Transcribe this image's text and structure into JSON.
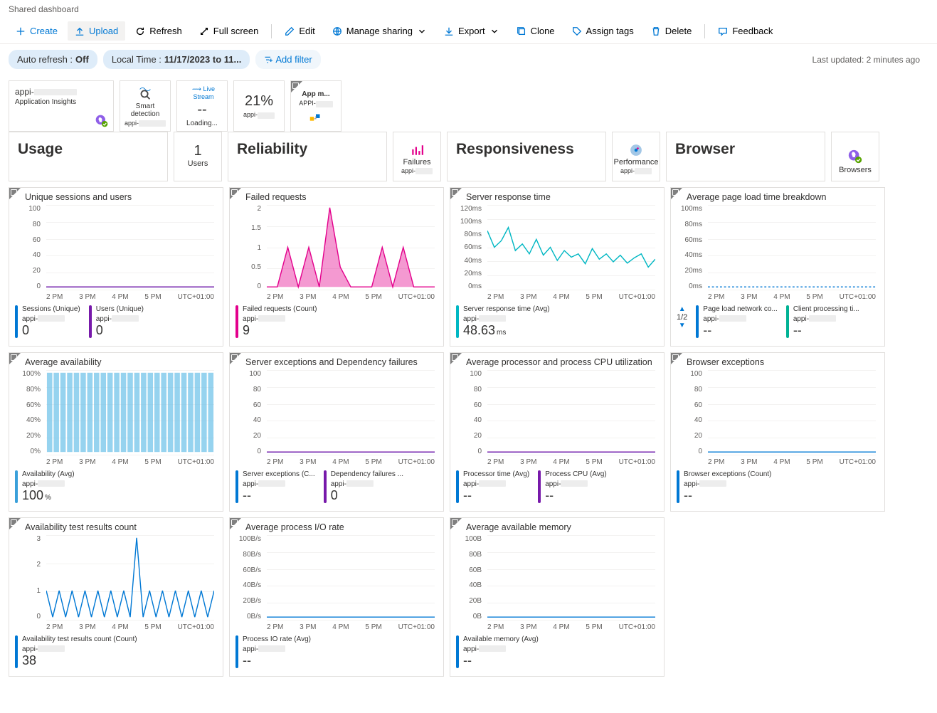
{
  "breadcrumb": "Shared dashboard",
  "toolbar": {
    "create": "Create",
    "upload": "Upload",
    "refresh": "Refresh",
    "fullscreen": "Full screen",
    "edit": "Edit",
    "sharing": "Manage sharing",
    "export": "Export",
    "clone": "Clone",
    "assign": "Assign tags",
    "delete": "Delete",
    "feedback": "Feedback"
  },
  "filters": {
    "autorefresh_label": "Auto refresh : ",
    "autorefresh_val": "Off",
    "time_label": "Local Time : ",
    "time_val": "11/17/2023 to 11...",
    "add": "Add filter"
  },
  "last_updated": "Last updated: 2 minutes ago",
  "top_tiles": {
    "ai": {
      "name": "appi-",
      "sub": "Application Insights"
    },
    "smart": {
      "title": "Smart detection",
      "sub": "appi-"
    },
    "live": {
      "title": "Live Stream",
      "val": "--",
      "sub": "Loading..."
    },
    "pct": {
      "val": "21%",
      "sub": "appi-"
    },
    "appmap": {
      "title": "App m...",
      "sub": "APPI-"
    }
  },
  "sections": {
    "usage": {
      "title": "Usage",
      "users_val": "1",
      "users_label": "Users"
    },
    "reliability": {
      "title": "Reliability",
      "aux": "Failures",
      "aux_sub": "appi-"
    },
    "responsiveness": {
      "title": "Responsiveness",
      "aux": "Performance",
      "aux_sub": "appi-"
    },
    "browser": {
      "title": "Browser",
      "aux": "Browsers"
    }
  },
  "charts": {
    "sessions": {
      "title": "Unique sessions and users",
      "m1": {
        "label": "Sessions (Unique)",
        "sub": "appi-",
        "val": "0"
      },
      "m2": {
        "label": "Users (Unique)",
        "sub": "appi-",
        "val": "0"
      }
    },
    "failed": {
      "title": "Failed requests",
      "m1": {
        "label": "Failed requests (Count)",
        "sub": "appi-",
        "val": "9"
      }
    },
    "server_resp": {
      "title": "Server response time",
      "m1": {
        "label": "Server response time (Avg)",
        "sub": "appi-",
        "val": "48.63",
        "unit": "ms"
      }
    },
    "pageload": {
      "title": "Average page load time breakdown",
      "pager": "1/2",
      "m1": {
        "label": "Page load network co...",
        "sub": "appi-",
        "val": "--"
      },
      "m2": {
        "label": "Client processing ti...",
        "sub": "appi-",
        "val": "--"
      }
    },
    "avail": {
      "title": "Average availability",
      "m1": {
        "label": "Availability (Avg)",
        "sub": "appi-",
        "val": "100",
        "unit": "%"
      }
    },
    "serverex": {
      "title": "Server exceptions and Dependency failures",
      "m1": {
        "label": "Server exceptions (C...",
        "sub": "appi-",
        "val": "--"
      },
      "m2": {
        "label": "Dependency failures ...",
        "sub": "appi-",
        "val": "0"
      }
    },
    "cpu": {
      "title": "Average processor and process CPU utilization",
      "m1": {
        "label": "Processor time (Avg)",
        "sub": "appi-",
        "val": "--"
      },
      "m2": {
        "label": "Process CPU (Avg)",
        "sub": "appi-",
        "val": "--"
      }
    },
    "browserex": {
      "title": "Browser exceptions",
      "m1": {
        "label": "Browser exceptions (Count)",
        "sub": "appi-",
        "val": "--"
      }
    },
    "availtest": {
      "title": "Availability test results count",
      "m1": {
        "label": "Availability test results count (Count)",
        "sub": "appi-",
        "val": "38"
      }
    },
    "io": {
      "title": "Average process I/O rate",
      "m1": {
        "label": "Process IO rate (Avg)",
        "sub": "appi-",
        "val": "--"
      }
    },
    "memory": {
      "title": "Average available memory",
      "m1": {
        "label": "Available memory (Avg)",
        "sub": "appi-",
        "val": "--"
      }
    }
  },
  "xaxis_labels": [
    "2 PM",
    "3 PM",
    "4 PM",
    "5 PM",
    "UTC+01:00"
  ],
  "chart_data": [
    {
      "id": "sessions",
      "type": "line",
      "yticks": [
        "100",
        "80",
        "60",
        "40",
        "20",
        "0"
      ],
      "series": [
        {
          "name": "Sessions",
          "color": "#0078d4",
          "values": [
            0,
            0,
            0,
            0,
            0,
            0,
            0,
            0,
            0,
            0
          ]
        },
        {
          "name": "Users",
          "color": "#7719aa",
          "values": [
            0,
            0,
            0,
            0,
            0,
            0,
            0,
            0,
            0,
            0
          ]
        }
      ]
    },
    {
      "id": "failed",
      "type": "area",
      "yticks": [
        "2",
        "1.5",
        "1",
        "0.5",
        "0"
      ],
      "series": [
        {
          "name": "Failed",
          "color": "#e3008c",
          "values": [
            0,
            0,
            1,
            0,
            1,
            0,
            2,
            0.5,
            0,
            0,
            0,
            1,
            0,
            1,
            0,
            0,
            0
          ]
        }
      ]
    },
    {
      "id": "server_resp",
      "type": "line",
      "yticks": [
        "120ms",
        "100ms",
        "80ms",
        "60ms",
        "40ms",
        "20ms",
        "0ms"
      ],
      "series": [
        {
          "name": "Resp",
          "color": "#00b7c3",
          "values": [
            85,
            60,
            70,
            90,
            55,
            65,
            50,
            72,
            48,
            60,
            40,
            55,
            45,
            50,
            35,
            58,
            42,
            50,
            38,
            48,
            36,
            44,
            50,
            30,
            42
          ]
        }
      ]
    },
    {
      "id": "pageload",
      "type": "line",
      "yticks": [
        "100ms",
        "80ms",
        "60ms",
        "40ms",
        "20ms",
        "0ms"
      ],
      "series": [
        {
          "name": "net",
          "color": "#0078d4",
          "dashed": true,
          "values": [
            0,
            0,
            0,
            0,
            0,
            0,
            0,
            0,
            0,
            0
          ]
        }
      ]
    },
    {
      "id": "avail",
      "type": "bar",
      "yticks": [
        "100%",
        "80%",
        "60%",
        "40%",
        "20%",
        "0%"
      ],
      "series": [
        {
          "name": "Avail",
          "color": "#69c0e8",
          "values": [
            100,
            100,
            100,
            100,
            100,
            100,
            100,
            100,
            100,
            100,
            100,
            100,
            100,
            100,
            100,
            100,
            100,
            100,
            100,
            100,
            100,
            100,
            100,
            100,
            100
          ]
        }
      ]
    },
    {
      "id": "serverex",
      "type": "line",
      "yticks": [
        "100",
        "80",
        "60",
        "40",
        "20",
        "0"
      ],
      "series": [
        {
          "name": "Server",
          "color": "#0078d4",
          "values": [
            0,
            0,
            0,
            0,
            0,
            0,
            0,
            0,
            0,
            0
          ]
        },
        {
          "name": "Dep",
          "color": "#7719aa",
          "values": [
            0,
            0,
            0,
            0,
            0,
            0,
            0,
            0,
            0,
            0
          ]
        }
      ]
    },
    {
      "id": "cpu",
      "type": "line",
      "yticks": [
        "100",
        "80",
        "60",
        "40",
        "20",
        "0"
      ],
      "series": [
        {
          "name": "Proc time",
          "color": "#0078d4",
          "values": [
            0,
            0,
            0,
            0,
            0,
            0,
            0,
            0,
            0,
            0
          ]
        },
        {
          "name": "Proc CPU",
          "color": "#7719aa",
          "values": [
            0,
            0,
            0,
            0,
            0,
            0,
            0,
            0,
            0,
            0
          ]
        }
      ]
    },
    {
      "id": "browserex",
      "type": "line",
      "yticks": [
        "100",
        "80",
        "60",
        "40",
        "20",
        "0"
      ],
      "series": [
        {
          "name": "Browser ex",
          "color": "#0078d4",
          "values": [
            0,
            0,
            0,
            0,
            0,
            0,
            0,
            0,
            0,
            0
          ]
        }
      ]
    },
    {
      "id": "availtest",
      "type": "line",
      "yticks": [
        "3",
        "2",
        "1",
        "0"
      ],
      "series": [
        {
          "name": "Count",
          "color": "#0078d4",
          "values": [
            1,
            0,
            1,
            0,
            1,
            0,
            1,
            0,
            1,
            0,
            1,
            0,
            1,
            0,
            3,
            0,
            1,
            0,
            1,
            0,
            1,
            0,
            1,
            0,
            1,
            0,
            1
          ]
        }
      ]
    },
    {
      "id": "io",
      "type": "line",
      "yticks": [
        "100B/s",
        "80B/s",
        "60B/s",
        "40B/s",
        "20B/s",
        "0B/s"
      ],
      "series": [
        {
          "name": "IO",
          "color": "#0078d4",
          "values": [
            0,
            0,
            0,
            0,
            0,
            0,
            0,
            0,
            0,
            0
          ]
        }
      ]
    },
    {
      "id": "memory",
      "type": "line",
      "yticks": [
        "100B",
        "80B",
        "60B",
        "40B",
        "20B",
        "0B"
      ],
      "series": [
        {
          "name": "Mem",
          "color": "#0078d4",
          "values": [
            0,
            0,
            0,
            0,
            0,
            0,
            0,
            0,
            0,
            0
          ]
        }
      ]
    }
  ]
}
